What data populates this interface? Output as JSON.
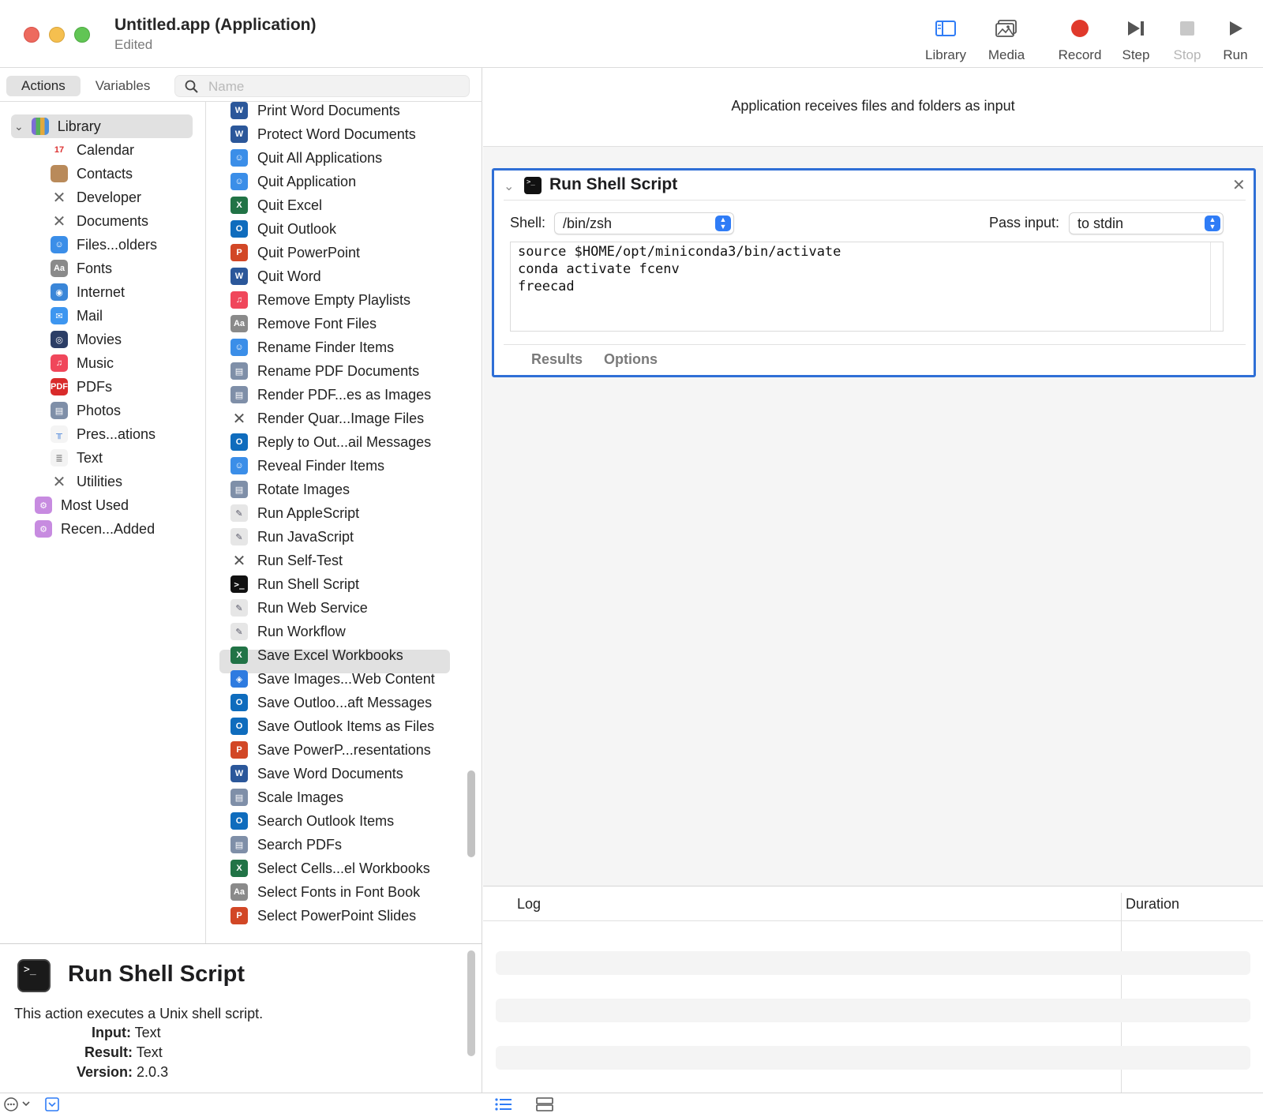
{
  "window": {
    "title": "Untitled.app (Application)",
    "subtitle": "Edited"
  },
  "toolbar": {
    "library": "Library",
    "media": "Media",
    "record": "Record",
    "step": "Step",
    "stop": "Stop",
    "run": "Run"
  },
  "left": {
    "tabs": [
      "Actions",
      "Variables"
    ],
    "search_placeholder": "Name"
  },
  "library": {
    "root": "Library",
    "items": [
      "Calendar",
      "Contacts",
      "Developer",
      "Documents",
      "Files...olders",
      "Fonts",
      "Internet",
      "Mail",
      "Movies",
      "Music",
      "PDFs",
      "Photos",
      "Pres...ations",
      "Text",
      "Utilities"
    ],
    "smart": [
      "Most Used",
      "Recen...Added"
    ]
  },
  "actions": [
    {
      "label": "Print Word Documents",
      "icon": "word"
    },
    {
      "label": "Protect Word Documents",
      "icon": "word"
    },
    {
      "label": "Quit All Applications",
      "icon": "finder"
    },
    {
      "label": "Quit Application",
      "icon": "finder"
    },
    {
      "label": "Quit Excel",
      "icon": "excel"
    },
    {
      "label": "Quit Outlook",
      "icon": "outlook"
    },
    {
      "label": "Quit PowerPoint",
      "icon": "powerpoint"
    },
    {
      "label": "Quit Word",
      "icon": "word"
    },
    {
      "label": "Remove Empty Playlists",
      "icon": "music"
    },
    {
      "label": "Remove Font Files",
      "icon": "fonts"
    },
    {
      "label": "Rename Finder Items",
      "icon": "finder"
    },
    {
      "label": "Rename PDF Documents",
      "icon": "preview"
    },
    {
      "label": "Render PDF...es as Images",
      "icon": "preview"
    },
    {
      "label": "Render Quar...Image Files",
      "icon": "tools"
    },
    {
      "label": "Reply to Out...ail Messages",
      "icon": "outlook"
    },
    {
      "label": "Reveal Finder Items",
      "icon": "finder"
    },
    {
      "label": "Rotate Images",
      "icon": "preview"
    },
    {
      "label": "Run AppleScript",
      "icon": "script"
    },
    {
      "label": "Run JavaScript",
      "icon": "script"
    },
    {
      "label": "Run Self-Test",
      "icon": "tools"
    },
    {
      "label": "Run Shell Script",
      "icon": "terminal"
    },
    {
      "label": "Run Web Service",
      "icon": "script"
    },
    {
      "label": "Run Workflow",
      "icon": "script"
    },
    {
      "label": "Save Excel Workbooks",
      "icon": "excel"
    },
    {
      "label": "Save Images...Web Content",
      "icon": "safari"
    },
    {
      "label": "Save Outloo...aft Messages",
      "icon": "outlook"
    },
    {
      "label": "Save Outlook Items as Files",
      "icon": "outlook"
    },
    {
      "label": "Save PowerP...resentations",
      "icon": "powerpoint"
    },
    {
      "label": "Save Word Documents",
      "icon": "word"
    },
    {
      "label": "Scale Images",
      "icon": "preview"
    },
    {
      "label": "Search Outlook Items",
      "icon": "outlook"
    },
    {
      "label": "Search PDFs",
      "icon": "preview"
    },
    {
      "label": "Select Cells...el Workbooks",
      "icon": "excel"
    },
    {
      "label": "Select Fonts in Font Book",
      "icon": "fonts"
    },
    {
      "label": "Select PowerPoint Slides",
      "icon": "powerpoint"
    }
  ],
  "info": {
    "title": "Run Shell Script",
    "description": "This action executes a Unix shell script.",
    "input_label": "Input:",
    "input_value": "Text",
    "result_label": "Result:",
    "result_value": "Text",
    "version_label": "Version:",
    "version_value": "2.0.3"
  },
  "workflow": {
    "header": "Application receives files and folders as input",
    "action": {
      "title": "Run Shell Script",
      "shell_label": "Shell:",
      "shell_value": "/bin/zsh",
      "pass_label": "Pass input:",
      "pass_value": "to stdin",
      "script_lines": [
        "source $HOME/opt/miniconda3/bin/activate",
        "conda activate fcenv",
        "freecad"
      ],
      "tabs": [
        "Results",
        "Options"
      ]
    }
  },
  "log": {
    "col_log": "Log",
    "col_duration": "Duration"
  },
  "colors": {
    "selection_border": "#2f6fd6",
    "record": "#e0392b",
    "popup_arrow": "#2f7cf6"
  }
}
